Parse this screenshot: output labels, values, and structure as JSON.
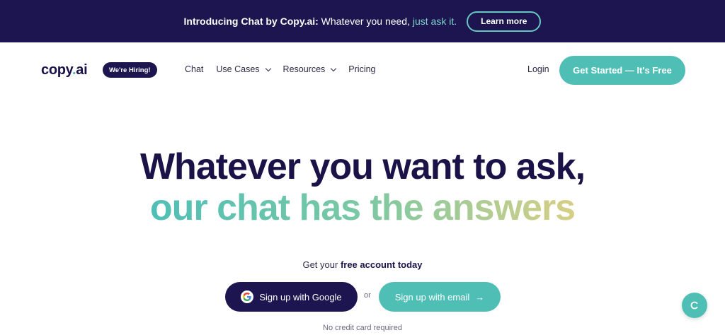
{
  "announcement": {
    "bold": "Introducing Chat by Copy.ai:",
    "text": " Whatever you need, ",
    "accent": "just ask it.",
    "button": "Learn more"
  },
  "nav": {
    "logo_main": "copy",
    "logo_dot": ".",
    "logo_end": "ai",
    "hiring_badge": "We're Hiring!",
    "links": [
      {
        "label": "Chat"
      },
      {
        "label": "Use Cases"
      },
      {
        "label": "Resources"
      },
      {
        "label": "Pricing"
      }
    ],
    "login": "Login",
    "cta": "Get Started — It's Free"
  },
  "hero": {
    "line1": "Whatever you want to ask,",
    "line2": "our chat has the answers",
    "sub_prefix": "Get your ",
    "sub_bold": "free account today",
    "google_button": "Sign up with Google",
    "or": "or",
    "email_button": "Sign up with email",
    "email_arrow": "→",
    "note": "No credit card required"
  },
  "colors": {
    "navy": "#1d1550",
    "teal": "#4fbfb6",
    "gradient_end": "#d7cf85"
  }
}
